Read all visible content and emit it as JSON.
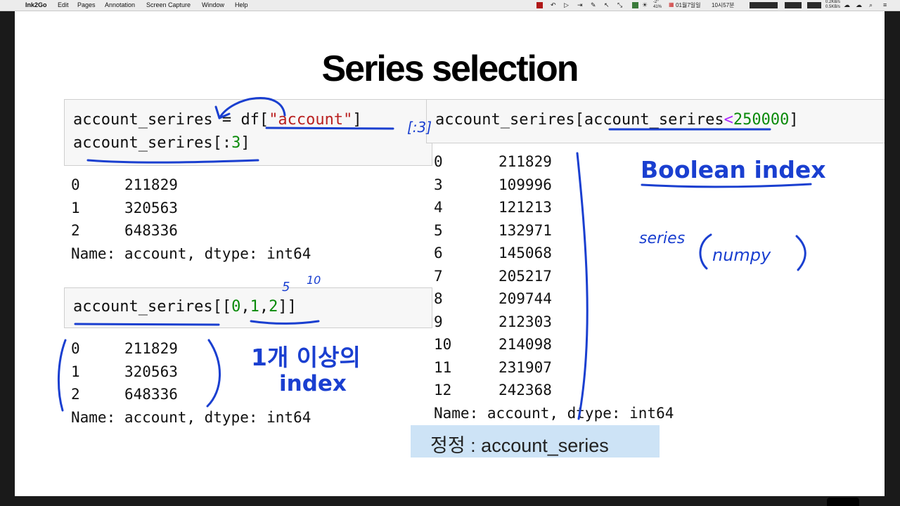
{
  "menubar": {
    "app": "Ink2Go",
    "menus": [
      "Edit",
      "Pages",
      "Annotation",
      "Screen Capture",
      "Window",
      "Help"
    ],
    "weather": "-2°",
    "battery_text": "41%",
    "date": "01월7일일",
    "time": "10시57분",
    "net_up": "0.2KB/s",
    "net_down": "0.5KB/s"
  },
  "slide": {
    "title": "Series selection",
    "cell1": {
      "line1": {
        "var": "account_serires",
        "eq": " = ",
        "df": "df[",
        "str": "\"account\"",
        "close": "]"
      },
      "line2": {
        "var": "account_serires[:",
        "num": "3",
        "close": "]"
      }
    },
    "out1": {
      "rows": [
        {
          "idx": "0",
          "val": "211829"
        },
        {
          "idx": "1",
          "val": "320563"
        },
        {
          "idx": "2",
          "val": "648336"
        }
      ],
      "footer": "Name: account, dtype: int64"
    },
    "cell2": {
      "prefix": "account_serires[[",
      "n0": "0",
      "n1": "1",
      "n2": "2",
      "suffix": "]]"
    },
    "out2": {
      "rows": [
        {
          "idx": "0",
          "val": "211829"
        },
        {
          "idx": "1",
          "val": "320563"
        },
        {
          "idx": "2",
          "val": "648336"
        }
      ],
      "footer": "Name: account, dtype: int64"
    },
    "cell3": {
      "var": "account_serires[account_serires",
      "op": "<",
      "num": "250000",
      "close": "]"
    },
    "out3": {
      "rows": [
        {
          "idx": "0",
          "val": "211829"
        },
        {
          "idx": "3",
          "val": "109996"
        },
        {
          "idx": "4",
          "val": "121213"
        },
        {
          "idx": "5",
          "val": "132971"
        },
        {
          "idx": "6",
          "val": "145068"
        },
        {
          "idx": "7",
          "val": "205217"
        },
        {
          "idx": "8",
          "val": "209744"
        },
        {
          "idx": "9",
          "val": "212303"
        },
        {
          "idx": "10",
          "val": "214098"
        },
        {
          "idx": "11",
          "val": "231907"
        },
        {
          "idx": "12",
          "val": "242368"
        }
      ],
      "footer": "Name: account, dtype: int64"
    },
    "annotations": {
      "multi_index_line1": "1개 이상의",
      "multi_index_line2": "index",
      "boolean_index": "Boolean index",
      "hand_series": "series",
      "hand_numpy": "numpy",
      "hand_slice": "[:3]",
      "hand_5": "5",
      "hand_10": "10"
    },
    "note": "정정 : account_series"
  },
  "colors": {
    "ink": "#1a3fd0",
    "string": "#ba2121",
    "number": "#0a8a0a",
    "operator": "#aa22ff",
    "note_bg": "#cde3f6"
  }
}
